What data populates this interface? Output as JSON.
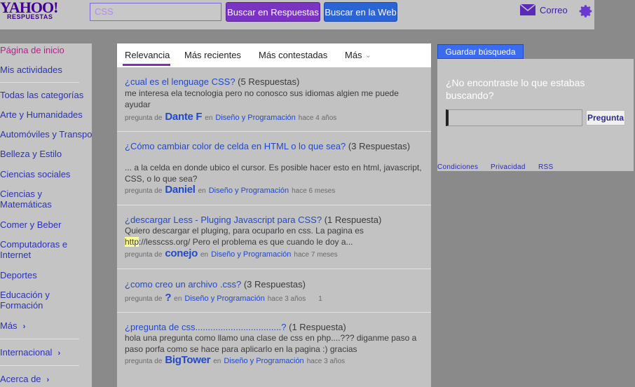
{
  "header": {
    "logo_main": "YAHOO!",
    "logo_sub": "RESPUESTAS",
    "search_value": "CSS",
    "btn_answers": "Buscar en Respuestas",
    "btn_web": "Buscar en la Web",
    "mail_label": "Correo"
  },
  "sidebar": {
    "home": "Página de inicio",
    "my_activity": "Mis actividades",
    "all_categories": "Todas las categorías",
    "arts": "Arte y Humanidades",
    "autos": "Automóviles y Transportes",
    "beauty": "Belleza y Estilo",
    "social": "Ciencias sociales",
    "science_1": "Ciencias y",
    "science_2": "Matemáticas",
    "food": "Comer y Beber",
    "computers_1": "Computadoras e",
    "computers_2": "Internet",
    "sports": "Deportes",
    "education_1": "Educación y",
    "education_2": "Formación",
    "more": "Más",
    "international": "Internacional",
    "about": "Acerca de"
  },
  "tabs": {
    "relevance": "Relevancia",
    "recent": "Más recientes",
    "answered": "Más contestadas",
    "more": "Más"
  },
  "results": [
    {
      "title": "¿cual es el lenguage CSS?",
      "count": "(5 Respuestas)",
      "snippet": "me interesa ela tecnologia pero no conosco sus idiomas algien me puede ayudar",
      "asked_by": "pregunta de",
      "user": "Dante F",
      "in": "en",
      "category": "Diseño y Programación",
      "time": "hace 4 años"
    },
    {
      "title": "¿Cómo cambiar color de celda en HTML o lo que sea?",
      "count": "(3 Respuestas)",
      "snippet": "... a la celda en donde ubico el cursor. Es posible hacer esto en html, javascript, CSS, o lo que sea?",
      "asked_by": "pregunta de",
      "user": "Daniel",
      "in": "en",
      "category": "Diseño y Programación",
      "time": "hace 6 meses"
    },
    {
      "title": "¿descargar Less - Pluging Javascript para CSS?",
      "count": "(1 Respuesta)",
      "snippet_1": "Quiero descargar el pluging, para ocuparlo en css. La pagina es",
      "snippet_hl": "http",
      "snippet_2": "://lesscss.org/ Pero el problema es que cuando le doy a...",
      "asked_by": "pregunta de",
      "user": "conejo",
      "in": "en",
      "category": "Diseño y Programación",
      "time": "hace 7 meses"
    },
    {
      "title": "¿como creo un archivo .css?",
      "count": "(3 Respuestas)",
      "asked_by": "pregunta de",
      "user": "?",
      "in": "en",
      "category": "Diseño y Programación",
      "time": "hace 3 años",
      "digit": "1"
    },
    {
      "title": "¿pregunta de css..................................?",
      "count": "(1 Respuesta)",
      "snippet": "hola una pregunta como llamo una clase de css en php....??? diganme paso a paso porfa como se hace para aplicarlo en la pagina :) gracias",
      "asked_by": "pregunta de",
      "user": "BigTower",
      "in": "en",
      "category": "Diseño y Programación",
      "time": "hace 3 años"
    }
  ],
  "right": {
    "save_search": "Guardar búsqueda",
    "not_found": "¿No encontraste lo que estabas buscando?",
    "ask_button": "Pregunta",
    "footer": [
      "Condiciones",
      "Privacidad",
      "RSS"
    ]
  },
  "icons": {
    "mail": "mail-icon",
    "gear": "gear-icon",
    "chevron": "chevron-right-icon"
  },
  "colors": {
    "brand": "#400090",
    "link": "#2449c8",
    "active_nav": "#c2188d",
    "button_purple": "#7b33c4",
    "button_blue": "#2a64d6"
  }
}
